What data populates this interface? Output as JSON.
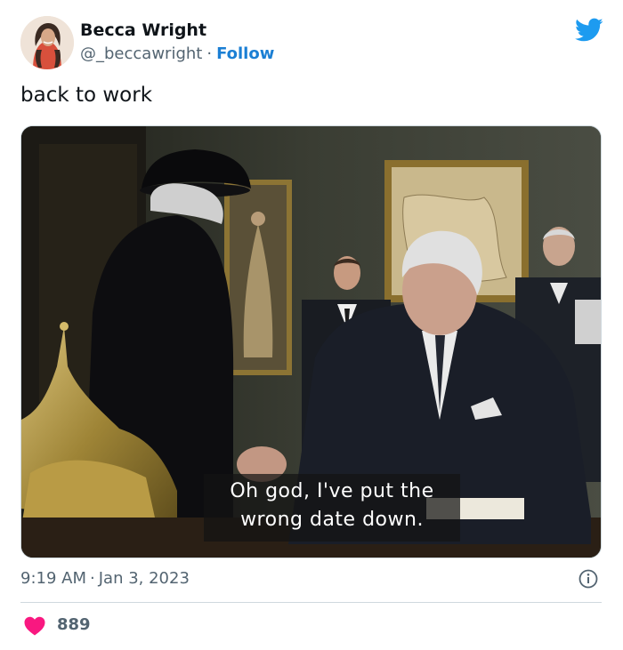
{
  "author": {
    "name": "Becca Wright",
    "handle": "@_beccawright",
    "follow_label": "Follow",
    "separator": "·"
  },
  "tweet": {
    "text": "back to work",
    "media_caption_line1": "Oh god, I've put the",
    "media_caption_line2": "wrong date down.",
    "time": "9:19 AM",
    "date": "Jan 3, 2023",
    "separator": "·"
  },
  "engagement": {
    "likes": "889"
  },
  "icons": {
    "platform": "twitter-bird-icon",
    "info": "info-icon",
    "like": "heart-icon"
  },
  "colors": {
    "accent": "#1d9bf0",
    "follow_text": "#1b7fd4",
    "heart": "#f91880",
    "secondary_text": "#536471"
  }
}
